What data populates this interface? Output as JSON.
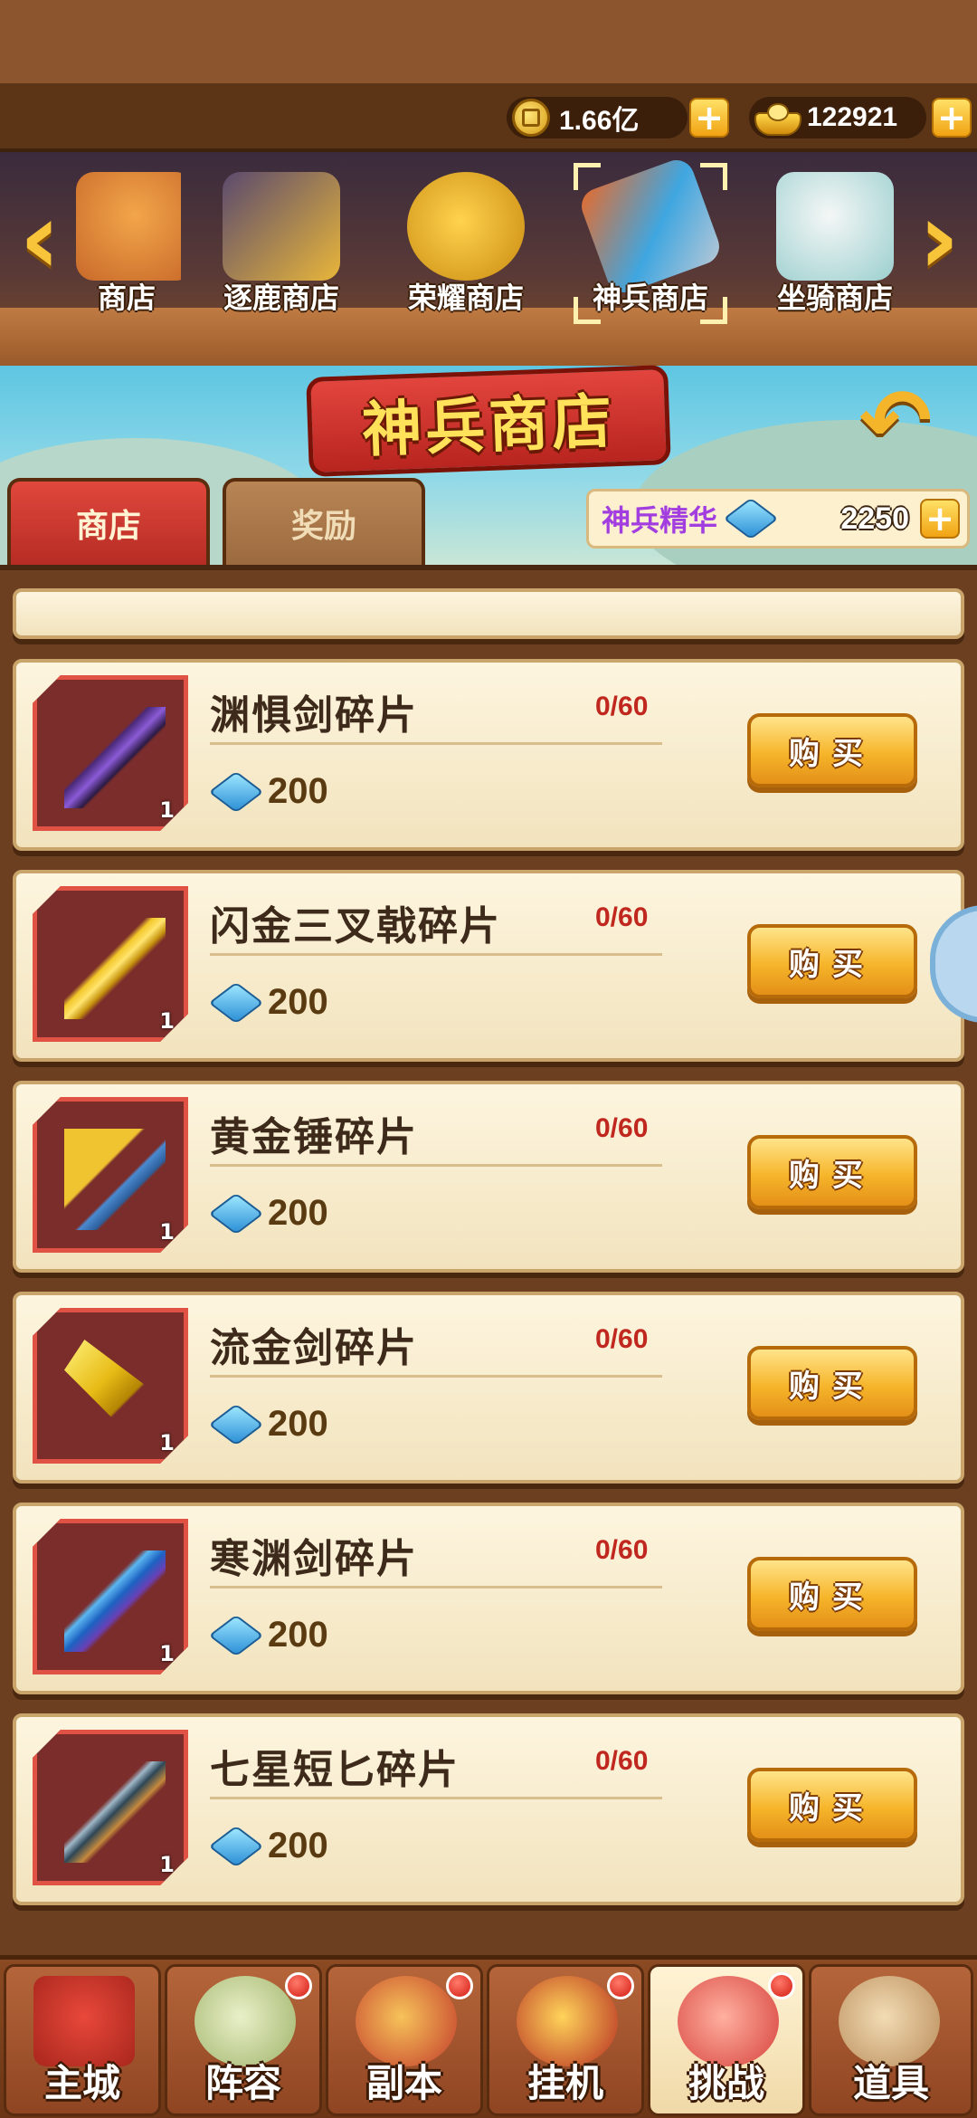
{
  "currency": {
    "coins": "1.66亿",
    "ingots": "122921"
  },
  "categories": [
    {
      "label": "商店",
      "icon": "corgi-icon"
    },
    {
      "label": "逐鹿商店",
      "icon": "treasure-chest-icon"
    },
    {
      "label": "荣耀商店",
      "icon": "honor-medal-icon"
    },
    {
      "label": "神兵商店",
      "icon": "divine-weapon-icon",
      "selected": true
    },
    {
      "label": "坐骑商店",
      "icon": "mount-deer-icon"
    }
  ],
  "page": {
    "title": "神兵商店"
  },
  "tabs": [
    {
      "label": "商店",
      "active": true
    },
    {
      "label": "奖励",
      "active": false
    }
  ],
  "essence": {
    "label": "神兵精华",
    "value": "2250"
  },
  "items": [
    {
      "name": "渊惧剑碎片",
      "limit": "0/60",
      "price": "200",
      "count": "1",
      "icon": "dark-sword-icon"
    },
    {
      "name": "闪金三叉戟碎片",
      "limit": "0/60",
      "price": "200",
      "count": "1",
      "icon": "golden-trident-icon"
    },
    {
      "name": "黄金锤碎片",
      "limit": "0/60",
      "price": "200",
      "count": "1",
      "icon": "golden-hammer-icon"
    },
    {
      "name": "流金剑碎片",
      "limit": "0/60",
      "price": "200",
      "count": "1",
      "icon": "golden-blade-icon"
    },
    {
      "name": "寒渊剑碎片",
      "limit": "0/60",
      "price": "200",
      "count": "1",
      "icon": "ice-sword-icon"
    },
    {
      "name": "七星短匕碎片",
      "limit": "0/60",
      "price": "200",
      "count": "1",
      "icon": "dagger-icon"
    }
  ],
  "buy_label": "购买",
  "nav": [
    {
      "label": "主城",
      "icon": "castle-icon",
      "badge": false
    },
    {
      "label": "阵容",
      "icon": "formation-icon",
      "badge": true
    },
    {
      "label": "副本",
      "icon": "dungeon-icon",
      "badge": true
    },
    {
      "label": "挂机",
      "icon": "idle-bag-icon",
      "badge": true
    },
    {
      "label": "挑战",
      "icon": "challenge-icon",
      "badge": true,
      "active": true
    },
    {
      "label": "道具",
      "icon": "items-icon",
      "badge": false
    }
  ],
  "colors": {
    "accent_red": "#e05244",
    "gold": "#f6b52a",
    "limit_red": "#c0271e",
    "essence_purple": "#a23ee0"
  }
}
